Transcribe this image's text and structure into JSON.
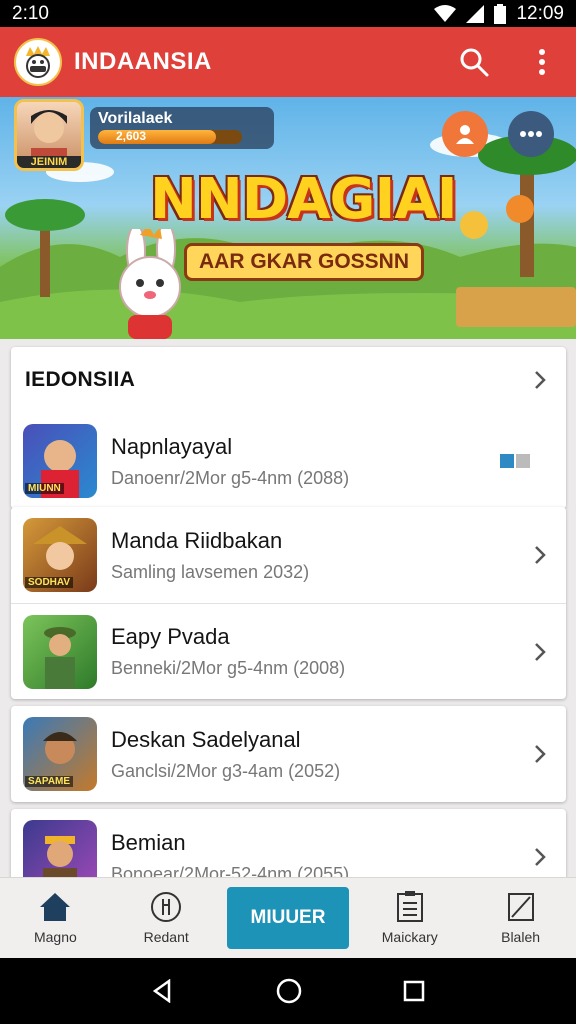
{
  "status_bar": {
    "time_left": "2:10",
    "time_right": "12:09"
  },
  "app_bar": {
    "title": "INDAANSIA",
    "logo_icon": "mascot-logo-icon",
    "search_icon": "search-icon",
    "menu_icon": "more-vert-icon"
  },
  "banner": {
    "player_name": "Vorilalaek",
    "player_xp": "2,603",
    "xp_progress": 0.82,
    "avatar_tag": "JEINIM",
    "title": "NNDAGIAI",
    "subtitle": "AAR GKAR GOSSNN"
  },
  "section": {
    "title": "IEDONSIIA",
    "items": [
      {
        "title": "Napnlayayal",
        "subtitle": "Danoenr/2Mor g5-4nm (2088)",
        "thumb_label": "MIUNN",
        "thumb_color": "#4a4fb8",
        "status_icon": "toggle-icon"
      }
    ]
  },
  "games": [
    {
      "title": "Manda Riidbakan",
      "subtitle": "Samling lavsemen 2032)",
      "thumb_label": "SODHAV",
      "thumb_color": "#d59a3a"
    },
    {
      "title": "Eapy Pvada",
      "subtitle": "Benneki/2Mor g5-4nm (2008)",
      "thumb_label": "",
      "thumb_color": "#4e9b3d"
    },
    {
      "title": "Deskan Sadelyanal",
      "subtitle": "Ganclsi/2Mor g3-4am (2052)",
      "thumb_label": "SAPAME",
      "thumb_color": "#c47a2a"
    },
    {
      "title": "Bemian",
      "subtitle": "Bonoear/2Mor-52-4nm (2055)",
      "thumb_label": "",
      "thumb_color": "#3b3a8e"
    }
  ],
  "bottom_nav": {
    "items": [
      {
        "label": "Magno",
        "icon": "home-icon"
      },
      {
        "label": "Redant",
        "icon": "compass-icon"
      },
      {
        "label": "MIUUER",
        "icon": ""
      },
      {
        "label": "Maickary",
        "icon": "list-icon"
      },
      {
        "label": "Blaleh",
        "icon": "edit-icon"
      }
    ]
  },
  "colors": {
    "app_bar": "#e0403a",
    "primary_nav": "#1e93b8"
  }
}
